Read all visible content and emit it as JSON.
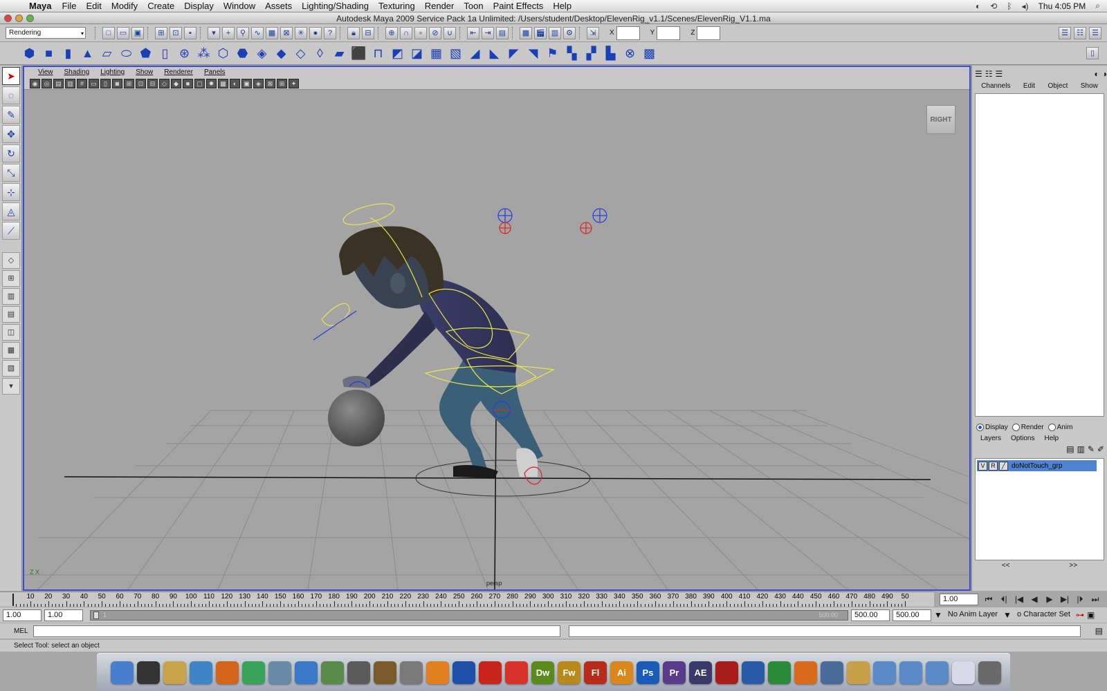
{
  "menubar": {
    "app": "Maya",
    "items": [
      "File",
      "Edit",
      "Modify",
      "Create",
      "Display",
      "Window",
      "Assets",
      "Lighting/Shading",
      "Texturing",
      "Render",
      "Toon",
      "Paint Effects",
      "Help"
    ],
    "clock": "Thu 4:05 PM"
  },
  "window": {
    "title": "Autodesk Maya 2009 Service Pack 1a Unlimited: /Users/student/Desktop/ElevenRig_v1.1/Scenes/ElevenRig_V1.1.ma"
  },
  "statusline": {
    "mode": "Rendering",
    "x_label": "X",
    "y_label": "Y",
    "z_label": "Z"
  },
  "panel": {
    "menus": [
      "View",
      "Shading",
      "Lighting",
      "Show",
      "Renderer",
      "Panels"
    ],
    "viewcube_label": "RIGHT",
    "camera_label": "persp",
    "axis_label": "Z X"
  },
  "channelbox": {
    "menus": [
      "Channels",
      "Edit",
      "Object",
      "Show"
    ]
  },
  "layers": {
    "modes": [
      "Display",
      "Render",
      "Anim"
    ],
    "selected_mode": "Display",
    "menus": [
      "Layers",
      "Options",
      "Help"
    ],
    "row": {
      "v": "V",
      "r": "R",
      "name": "doNotTouch_grp"
    },
    "nav_left": "<<",
    "nav_right": ">>"
  },
  "timeslider": {
    "ticks": [
      10,
      20,
      30,
      40,
      50,
      60,
      70,
      80,
      90,
      100,
      110,
      120,
      130,
      140,
      150,
      160,
      170,
      180,
      190,
      200,
      210,
      220,
      230,
      240,
      250,
      260,
      270,
      280,
      290,
      300,
      310,
      320,
      330,
      340,
      350,
      360,
      370,
      380,
      390,
      400,
      410,
      420,
      430,
      440,
      450,
      460,
      470,
      480,
      490,
      "50"
    ],
    "current_frame": "1.00"
  },
  "rangeslider": {
    "start": "1.00",
    "playback_start": "1.00",
    "bar_start_label": "1",
    "bar_end_label": "500.00",
    "playback_end": "500.00",
    "end": "500.00",
    "anim_layer": "No Anim Layer",
    "character_set": "o Character Set"
  },
  "cmdline": {
    "label": "MEL"
  },
  "helpline": {
    "text": "Select Tool: select an object"
  },
  "dock": {
    "apps": [
      {
        "name": "finder",
        "label": "",
        "color": "#4a7fd0"
      },
      {
        "name": "dashboard",
        "label": "",
        "color": "#333333"
      },
      {
        "name": "pencil",
        "label": "",
        "color": "#c9a24a"
      },
      {
        "name": "safari",
        "label": "",
        "color": "#3f86c8"
      },
      {
        "name": "firefox",
        "label": "",
        "color": "#d4661c"
      },
      {
        "name": "chrome",
        "label": "",
        "color": "#3aa35a"
      },
      {
        "name": "preview",
        "label": "",
        "color": "#6a8aa8"
      },
      {
        "name": "itunes",
        "label": "",
        "color": "#3a78c8"
      },
      {
        "name": "iphoto",
        "label": "",
        "color": "#5a8a4a"
      },
      {
        "name": "imovie",
        "label": "",
        "color": "#5a5a5a"
      },
      {
        "name": "garageband",
        "label": "",
        "color": "#7a5a2a"
      },
      {
        "name": "system-prefs",
        "label": "",
        "color": "#7a7a7a"
      },
      {
        "name": "vlc",
        "label": "",
        "color": "#e2801f"
      },
      {
        "name": "audacity",
        "label": "",
        "color": "#1f4fa8"
      },
      {
        "name": "acrobat",
        "label": "",
        "color": "#c8241c"
      },
      {
        "name": "acrobat-reader",
        "label": "",
        "color": "#d8322a"
      },
      {
        "name": "dreamweaver",
        "label": "Dw",
        "color": "#5a8a1c"
      },
      {
        "name": "fireworks",
        "label": "Fw",
        "color": "#b88a1c"
      },
      {
        "name": "flash",
        "label": "Fl",
        "color": "#b82a1c"
      },
      {
        "name": "illustrator",
        "label": "Ai",
        "color": "#d8881c"
      },
      {
        "name": "photoshop",
        "label": "Ps",
        "color": "#1c5ab8"
      },
      {
        "name": "premiere",
        "label": "Pr",
        "color": "#5a3a8a"
      },
      {
        "name": "after-effects",
        "label": "AE",
        "color": "#3a3a6a"
      },
      {
        "name": "maya",
        "label": "",
        "color": "#a81c1c"
      },
      {
        "name": "word",
        "label": "",
        "color": "#2a5aa8"
      },
      {
        "name": "excel",
        "label": "",
        "color": "#2a8a3a"
      },
      {
        "name": "powerpoint",
        "label": "",
        "color": "#d86a1c"
      },
      {
        "name": "xcode",
        "label": "",
        "color": "#4a6a9a"
      },
      {
        "name": "contacts",
        "label": "",
        "color": "#c8a04a"
      },
      {
        "name": "applications-folder",
        "label": "",
        "color": "#5a8ac8"
      },
      {
        "name": "documents-folder",
        "label": "",
        "color": "#5a8ac8"
      },
      {
        "name": "downloads-folder",
        "label": "",
        "color": "#5a8ac8"
      },
      {
        "name": "screenshot-doc",
        "label": "",
        "color": "#d8d8e8"
      },
      {
        "name": "trash",
        "label": "",
        "color": "#6a6a6a"
      }
    ]
  }
}
